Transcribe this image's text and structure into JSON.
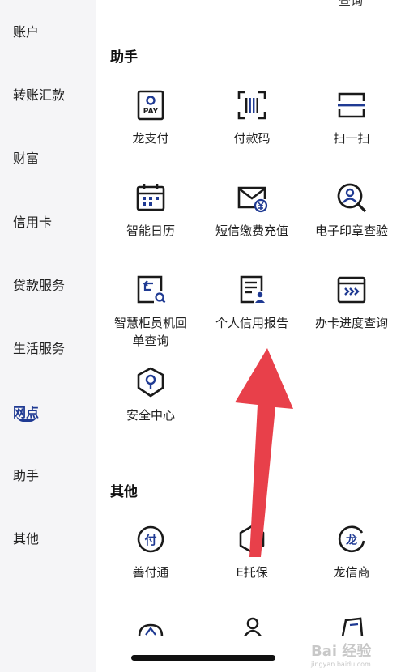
{
  "sidebar": {
    "items": [
      {
        "label": "账户"
      },
      {
        "label": "转账汇款"
      },
      {
        "label": "财富"
      },
      {
        "label": "信用卡"
      },
      {
        "label": "贷款服务"
      },
      {
        "label": "生活服务"
      },
      {
        "label": "网点"
      },
      {
        "label": "助手"
      },
      {
        "label": "其他"
      }
    ],
    "active_index": 6
  },
  "top_cut_label": "查询",
  "assistant": {
    "title": "助手",
    "tiles": [
      {
        "label": "龙支付",
        "icon": "pay-icon",
        "icon_text": "PAY"
      },
      {
        "label": "付款码",
        "icon": "barcode-icon"
      },
      {
        "label": "扫一扫",
        "icon": "scan-icon"
      },
      {
        "label": "智能日历",
        "icon": "calendar-icon"
      },
      {
        "label": "短信缴费充值",
        "icon": "sms-payment-icon"
      },
      {
        "label": "电子印章查验",
        "icon": "seal-search-icon"
      },
      {
        "label": "智慧柜员机回\n单查询",
        "icon": "receipt-search-icon"
      },
      {
        "label": "个人信用报告",
        "icon": "credit-report-icon"
      },
      {
        "label": "办卡进度查询",
        "icon": "card-progress-icon"
      },
      {
        "label": "安全中心",
        "icon": "shield-icon"
      }
    ]
  },
  "other": {
    "title": "其他",
    "tiles": [
      {
        "label": "善付通",
        "icon": "fu-icon",
        "icon_text": "付"
      },
      {
        "label": "E托保",
        "icon": "hexagon-icon"
      },
      {
        "label": "龙信商",
        "icon": "dragon-icon",
        "icon_text": "龙"
      }
    ]
  },
  "colors": {
    "accent": "#1f3a93",
    "arrow": "#e8404a",
    "sidebar_bg": "#f5f5f7"
  },
  "watermark": {
    "brand": "Bai 经验",
    "url": "jingyan.baidu.com"
  }
}
